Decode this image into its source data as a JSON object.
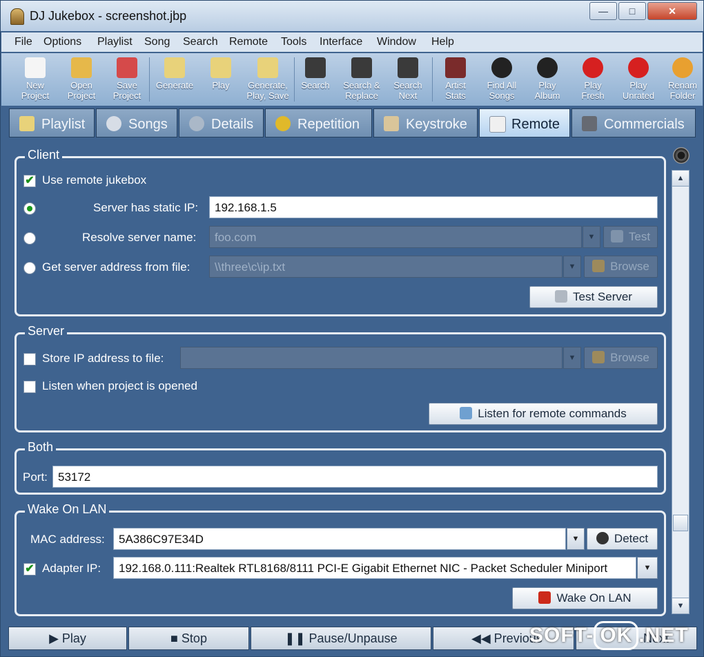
{
  "window": {
    "title": "DJ Jukebox - screenshot.jbp",
    "controls": {
      "minimize": "—",
      "maximize": "□",
      "close": "✕"
    }
  },
  "menu": [
    "File",
    "Options",
    "Playlist",
    "Song",
    "Search",
    "Remote",
    "Tools",
    "Interface",
    "Window",
    "Help"
  ],
  "toolbar": [
    {
      "label": "New\nProject",
      "icon": "new-project-icon",
      "color": "#f5f5f5"
    },
    {
      "label": "Open\nProject",
      "icon": "open-project-icon",
      "color": "#e6b84a"
    },
    {
      "label": "Save\nProject",
      "icon": "save-project-icon",
      "color": "#d54a4a"
    },
    {
      "label": "Generate",
      "icon": "generate-icon",
      "color": "#e8d27a"
    },
    {
      "label": "Play",
      "icon": "play-icon",
      "color": "#e8d27a"
    },
    {
      "label": "Generate,\nPlay, Save",
      "icon": "generate-play-save-icon",
      "color": "#e8d27a"
    },
    {
      "label": "Search",
      "icon": "binoculars-icon",
      "color": "#3a3a3a"
    },
    {
      "label": "Search &\nReplace",
      "icon": "search-replace-icon",
      "color": "#3a3a3a"
    },
    {
      "label": "Search\nNext",
      "icon": "search-next-icon",
      "color": "#3a3a3a"
    },
    {
      "label": "Artist\nStats",
      "icon": "artist-icon",
      "color": "#7a2b2b"
    },
    {
      "label": "Find All\nSongs",
      "icon": "find-songs-icon",
      "color": "#222222"
    },
    {
      "label": "Play\nAlbum",
      "icon": "play-album-icon",
      "color": "#222222"
    },
    {
      "label": "Play\nFresh",
      "icon": "apple-icon",
      "color": "#d62020"
    },
    {
      "label": "Play\nUnrated",
      "icon": "play-unrated-icon",
      "color": "#d62020"
    },
    {
      "label": "Renam\nFolder",
      "icon": "rename-folder-icon",
      "color": "#e8a030"
    }
  ],
  "tabs": [
    {
      "label": "Playlist",
      "icon": "playlist-icon",
      "color": "#e8d27a",
      "active": false
    },
    {
      "label": "Songs",
      "icon": "songs-icon",
      "color": "#d7dde6",
      "active": false
    },
    {
      "label": "Details",
      "icon": "gear-icon",
      "color": "#aab8c8",
      "active": false
    },
    {
      "label": "Repetition",
      "icon": "repetition-icon",
      "color": "#e0b92a",
      "active": false
    },
    {
      "label": "Keystroke",
      "icon": "keystroke-icon",
      "color": "#d9c59a",
      "active": false
    },
    {
      "label": "Remote",
      "icon": "remote-icon",
      "color": "#f0f0f0",
      "active": true
    },
    {
      "label": "Commercials",
      "icon": "commercials-icon",
      "color": "#666a72",
      "active": false
    }
  ],
  "client": {
    "title": "Client",
    "use_remote": "Use remote jukebox",
    "static_ip_label": "Server has static IP:",
    "static_ip_value": "192.168.1.5",
    "resolve_label": "Resolve server name:",
    "resolve_value": "foo.com",
    "test_label": "Test",
    "file_label": "Get server address from file:",
    "file_value": "\\\\three\\c\\ip.txt",
    "browse_label": "Browse",
    "test_server_label": "Test Server"
  },
  "server": {
    "title": "Server",
    "store_ip_label": "Store IP address to file:",
    "browse_label": "Browse",
    "listen_opened_label": "Listen when project is opened",
    "listen_button": "Listen for remote commands"
  },
  "both": {
    "title": "Both",
    "port_label": "Port:",
    "port_value": "53172"
  },
  "wol": {
    "title": "Wake On LAN",
    "mac_label": "MAC address:",
    "mac_value": "5A386C97E34D",
    "detect_label": "Detect",
    "adapter_label": "Adapter IP:",
    "adapter_value": "192.168.0.111:Realtek RTL8168/8111 PCI-E Gigabit Ethernet NIC - Packet Scheduler Miniport",
    "wake_button": "Wake On LAN"
  },
  "player": [
    {
      "label": "▶  Play"
    },
    {
      "label": "■  Stop"
    },
    {
      "label": "❚❚  Pause/Unpause"
    },
    {
      "label": "◀◀  Previous"
    },
    {
      "label": "Next"
    }
  ],
  "watermark": {
    "left": "SOFT-",
    "ok": "OK",
    "right": ".NET"
  }
}
